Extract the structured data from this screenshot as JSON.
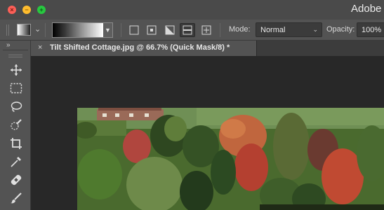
{
  "window": {
    "title": "Adobe P",
    "close_icon": "close-icon",
    "minimize_icon": "minimize-icon",
    "maximize_icon": "maximize-icon"
  },
  "options": {
    "gradient_type_icons": [
      "linear-gradient-icon",
      "radial-gradient-icon",
      "angle-gradient-icon",
      "reflected-gradient-icon",
      "diamond-gradient-icon"
    ],
    "active_gradient_type": "reflected-gradient-icon",
    "mode_label": "Mode:",
    "mode_value": "Normal",
    "opacity_label": "Opacity:",
    "opacity_value": "100%"
  },
  "tools": {
    "collapse_glyph": "»",
    "items": [
      "move-icon",
      "marquee-icon",
      "lasso-icon",
      "quick-selection-icon",
      "crop-icon",
      "eyedropper-icon",
      "healing-brush-icon",
      "brush-icon"
    ]
  },
  "document": {
    "tab_close": "×",
    "tab_title": "Tilt Shifted Cottage.jpg @ 66.7% (Quick Mask/8) *"
  },
  "colors": {
    "close": "#fc5f57",
    "minimize": "#febc2e",
    "maximize": "#28c840",
    "panel": "#535353",
    "canvas": "#282828"
  }
}
